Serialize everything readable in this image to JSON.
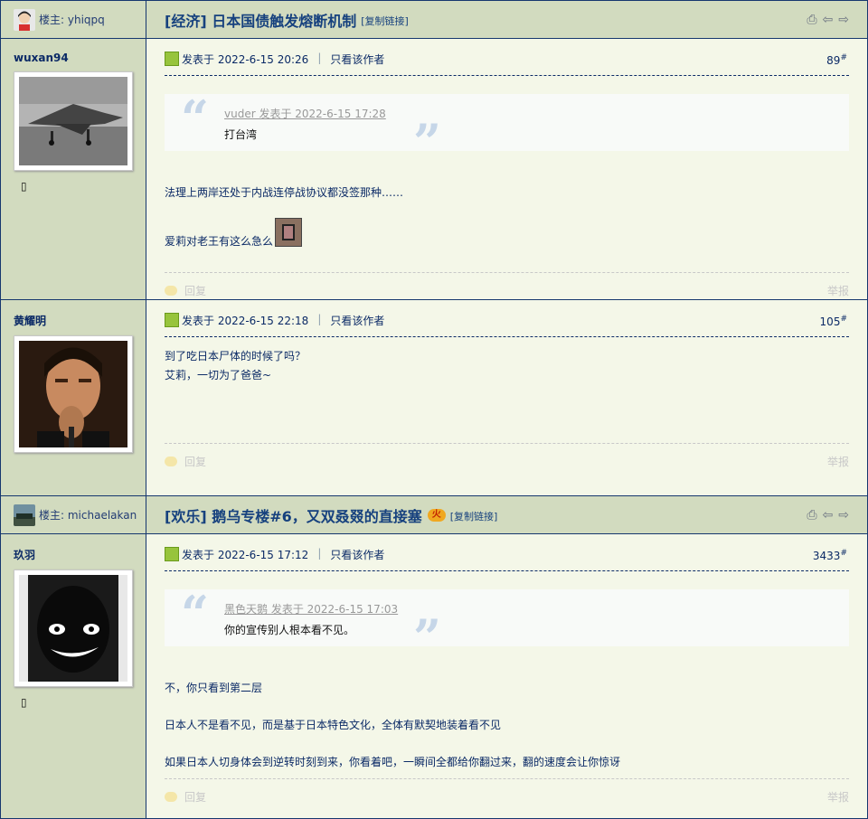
{
  "thread1": {
    "op_label": "楼主: yhiqpq",
    "title": "[经济] 日本国债触发熔断机制",
    "copy_link": "复制链接",
    "posts": [
      {
        "username": "wuxan94",
        "posted": "发表于 2022-6-15 20:26",
        "only_author": "只看该作者",
        "floor": "89",
        "quote_header": "vuder 发表于 2022-6-15 17:28",
        "quote_body": "打台湾",
        "body": [
          "法理上两岸还处于内战连停战协议都没签那种……",
          "爱莉对老王有这么急么"
        ],
        "reply": "回复",
        "report": "举报"
      },
      {
        "username": "黄耀明",
        "posted": "发表于 2022-6-15 22:18",
        "only_author": "只看该作者",
        "floor": "105",
        "body": [
          "到了吃日本尸体的时候了吗？",
          "艾莉，一切为了爸爸~"
        ],
        "reply": "回复",
        "report": "举报"
      }
    ]
  },
  "thread2": {
    "op_label": "楼主: michaelakan",
    "title": "[欢乐] 鹅乌专楼#6，又双叒叕的直接塞",
    "hot_badge": "火",
    "copy_link": "复制链接",
    "posts": [
      {
        "username": "玖羽",
        "posted": "发表于 2022-6-15 17:12",
        "only_author": "只看该作者",
        "floor": "3433",
        "quote_header": "黑色天鹅 发表于 2022-6-15 17:03",
        "quote_body": "你的宣传别人根本看不见。",
        "body": [
          "不，你只看到第二层",
          "日本人不是看不见，而是基于日本特色文化，全体有默契地装着看不见",
          "如果日本人切身体会到逆转时刻到来，你看着吧，一瞬间全都给你翻过来，翻的速度会让你惊讶"
        ],
        "reply": "回复",
        "report": "举报"
      }
    ]
  },
  "floor_mark": "#",
  "colors": {
    "sidebar": "#d2dbbf",
    "content": "#f4f7e8",
    "border": "#16376e",
    "link": "#16417e"
  }
}
